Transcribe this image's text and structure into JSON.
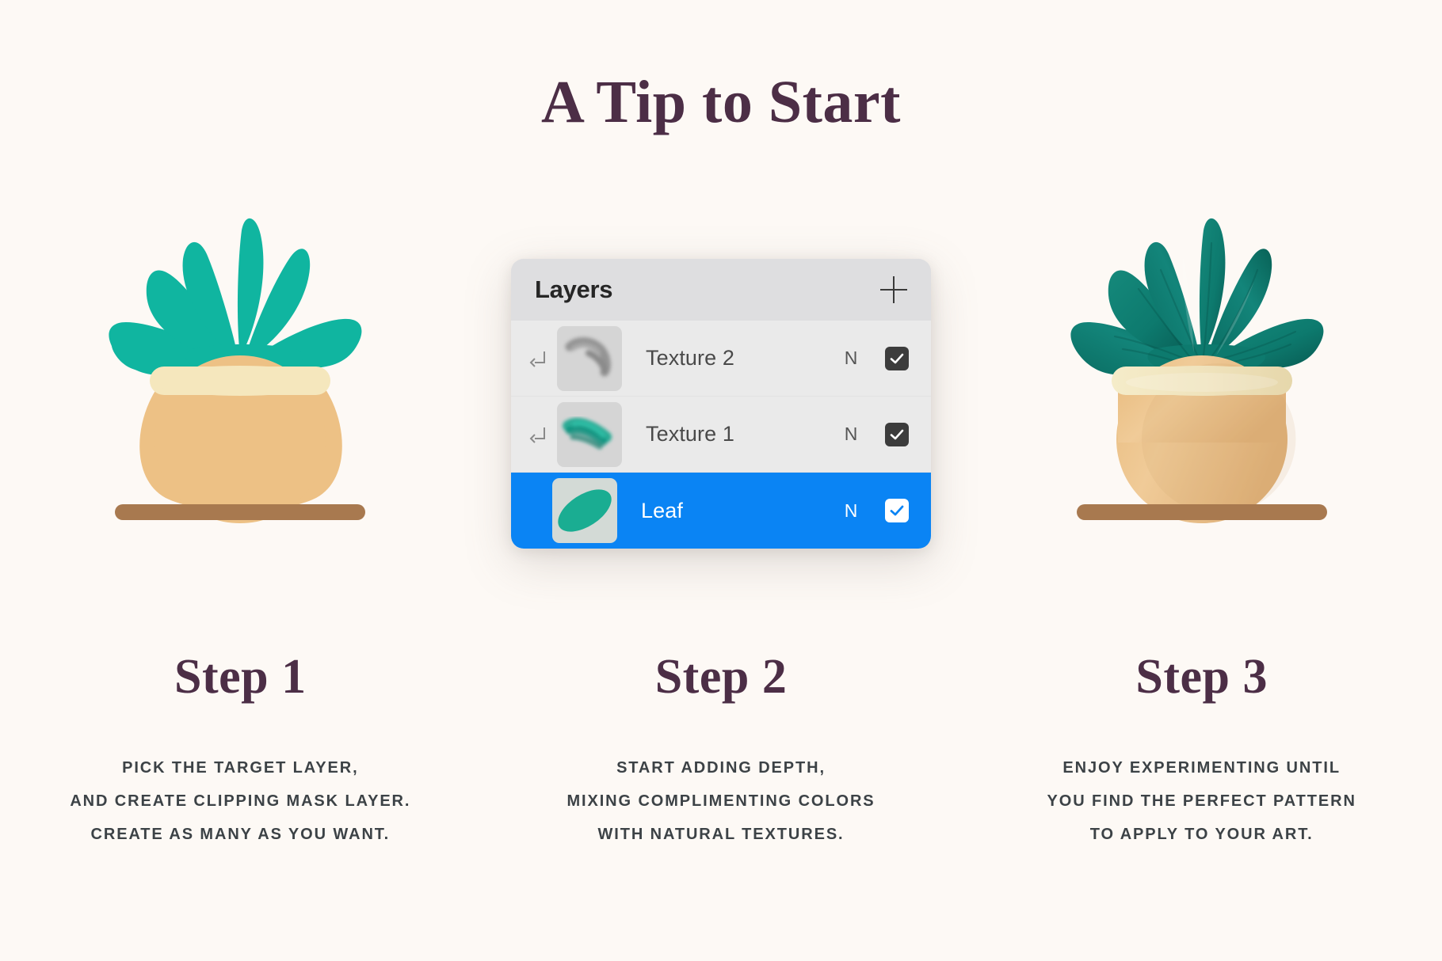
{
  "page": {
    "title": "A Tip to Start",
    "background_color": "#fdf9f5",
    "heading_color": "#4c2e46",
    "body_text_color": "#3c4246"
  },
  "illustrations": {
    "left": {
      "name": "plant-flat",
      "leaf_color": "#10b5a0",
      "pot_color": "#edc185",
      "rim_color": "#f5e7bd",
      "shelf_color": "#a8794f"
    },
    "right": {
      "name": "plant-textured",
      "leaf_color": "#0d7a6e",
      "leaf_shade_color": "#085a52",
      "pot_color": "#edc185",
      "rim_color": "#f2e9c8",
      "shelf_color": "#a8794f"
    }
  },
  "layers_panel": {
    "title": "Layers",
    "add_icon": "plus-icon",
    "header_bg": "#dedee0",
    "row_bg": "#eaeaea",
    "selected_bg": "#0a84f4",
    "rows": [
      {
        "name": "Texture 2",
        "blend_mode": "N",
        "visible": true,
        "clipping_mask": true,
        "selected": false,
        "thumbnail": "gray-brush-stroke"
      },
      {
        "name": "Texture 1",
        "blend_mode": "N",
        "visible": true,
        "clipping_mask": true,
        "selected": false,
        "thumbnail": "teal-brush-stroke"
      },
      {
        "name": "Leaf",
        "blend_mode": "N",
        "visible": true,
        "clipping_mask": false,
        "selected": true,
        "thumbnail": "teal-leaf-shape"
      }
    ]
  },
  "steps": [
    {
      "title": "Step 1",
      "lines": [
        "PICK THE TARGET LAYER,",
        "AND CREATE CLIPPING MASK LAYER.",
        "CREATE AS MANY AS YOU WANT."
      ]
    },
    {
      "title": "Step 2",
      "lines": [
        "START ADDING DEPTH,",
        "MIXING COMPLIMENTING COLORS",
        "WITH NATURAL TEXTURES."
      ]
    },
    {
      "title": "Step 3",
      "lines": [
        "ENJOY EXPERIMENTING UNTIL",
        "YOU FIND THE PERFECT PATTERN",
        "TO APPLY TO YOUR ART."
      ]
    }
  ]
}
